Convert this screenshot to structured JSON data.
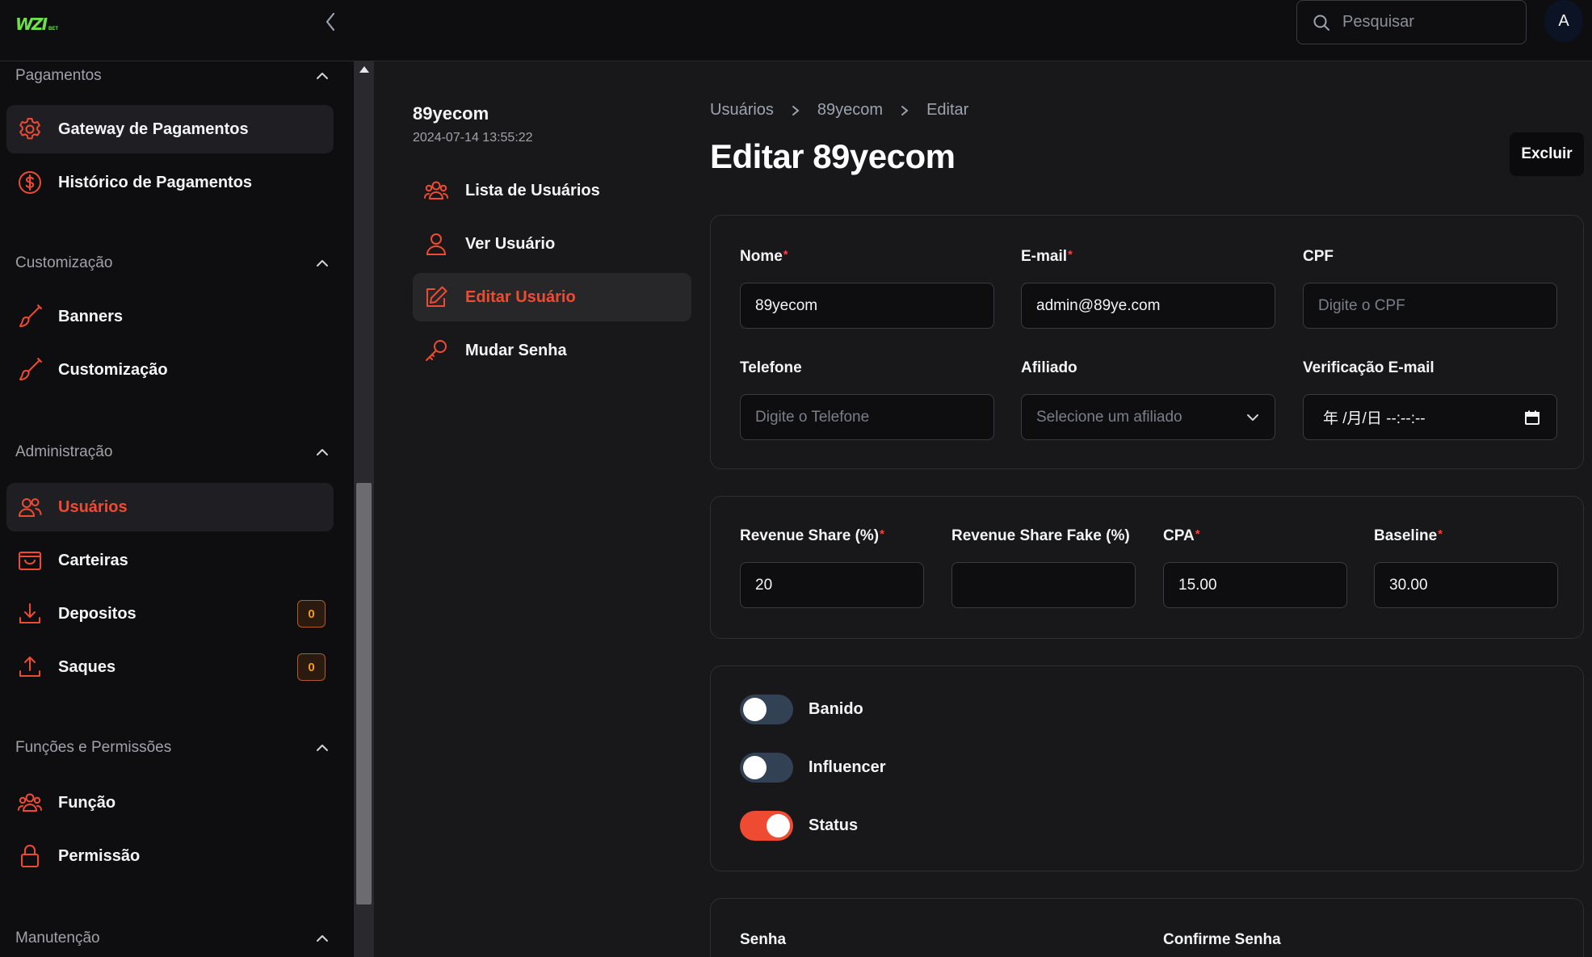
{
  "topbar": {
    "logo_text": "WZI",
    "logo_sub": "BET",
    "search_placeholder": "Pesquisar",
    "avatar_initial": "A"
  },
  "sidebar": {
    "sections": [
      {
        "title": "Pagamentos",
        "items": [
          {
            "label": "Gateway de Pagamentos",
            "icon": "gear-icon"
          },
          {
            "label": "Histórico de Pagamentos",
            "icon": "dollar-circle-icon"
          }
        ]
      },
      {
        "title": "Customização",
        "items": [
          {
            "label": "Banners",
            "icon": "brush-icon"
          },
          {
            "label": "Customização",
            "icon": "brush-icon"
          }
        ]
      },
      {
        "title": "Administração",
        "items": [
          {
            "label": "Usuários",
            "icon": "users-icon"
          },
          {
            "label": "Carteiras",
            "icon": "wallet-icon"
          },
          {
            "label": "Depositos",
            "icon": "download-icon",
            "badge": "0"
          },
          {
            "label": "Saques",
            "icon": "upload-icon",
            "badge": "0"
          }
        ]
      },
      {
        "title": "Funções e Permissões",
        "items": [
          {
            "label": "Função",
            "icon": "users-icon"
          },
          {
            "label": "Permissão",
            "icon": "lock-icon"
          }
        ]
      },
      {
        "title": "Manutenção",
        "items": []
      }
    ]
  },
  "user": {
    "name": "89yecom",
    "created_at": "2024-07-14 13:55:22"
  },
  "subnav": {
    "items": [
      {
        "label": "Lista de Usuários",
        "icon": "users-icon"
      },
      {
        "label": "Ver Usuário",
        "icon": "user-icon"
      },
      {
        "label": "Editar Usuário",
        "icon": "edit-icon"
      },
      {
        "label": "Mudar Senha",
        "icon": "key-icon"
      }
    ]
  },
  "breadcrumb": [
    "Usuários",
    "89yecom",
    "Editar"
  ],
  "page": {
    "title": "Editar 89yecom",
    "delete_label": "Excluir"
  },
  "form": {
    "nome": {
      "label": "Nome",
      "value": "89yecom"
    },
    "email": {
      "label": "E-mail",
      "value": "admin@89ye.com"
    },
    "cpf": {
      "label": "CPF",
      "placeholder": "Digite o CPF"
    },
    "telefone": {
      "label": "Telefone",
      "placeholder": "Digite o Telefone"
    },
    "afiliado": {
      "label": "Afiliado",
      "placeholder": "Selecione um afiliado"
    },
    "verificacao": {
      "label": "Verificação E-mail",
      "value": "年 /月/日 --:--:--"
    },
    "revenue_share": {
      "label": "Revenue Share (%)",
      "value": "20"
    },
    "revenue_share_fake": {
      "label": "Revenue Share Fake (%)",
      "value": ""
    },
    "cpa": {
      "label": "CPA",
      "value": "15.00"
    },
    "baseline": {
      "label": "Baseline",
      "value": "30.00"
    },
    "required_mark": "*",
    "toggles": [
      {
        "label": "Banido",
        "on": false
      },
      {
        "label": "Influencer",
        "on": false
      },
      {
        "label": "Status",
        "on": true
      }
    ],
    "senha": {
      "label": "Senha"
    },
    "confirme_senha": {
      "label": "Confirme Senha"
    }
  },
  "colors": {
    "accent": "#ef4b32",
    "logo": "#6ee04a",
    "badge": "#f59e0b"
  }
}
